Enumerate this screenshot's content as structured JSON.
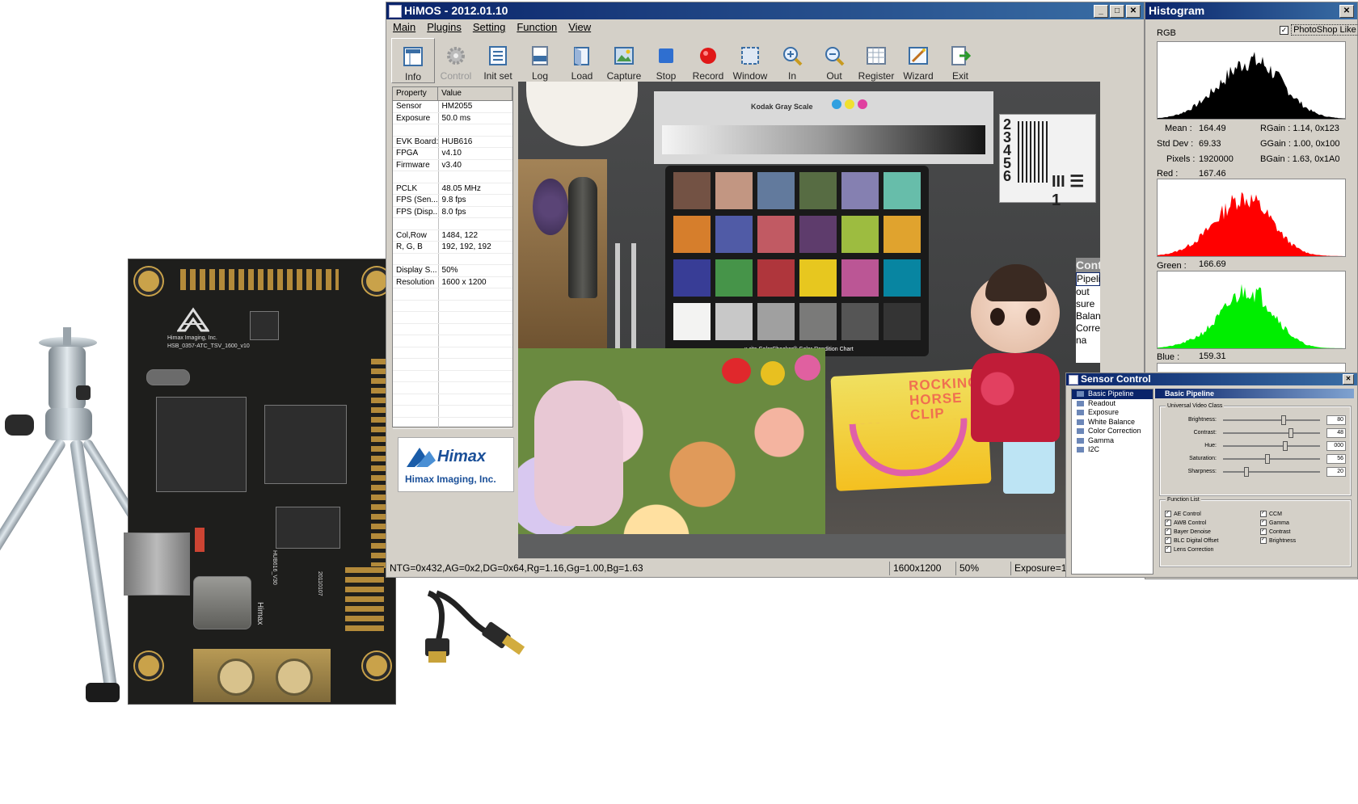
{
  "app": {
    "title": "HiMOS - 2012.01.10",
    "menu": [
      "Main",
      "Plugins",
      "Setting",
      "Function",
      "View"
    ],
    "toolbar": [
      "Info",
      "Control",
      "Init set",
      "Log",
      "Load",
      "Capture",
      "Stop",
      "Record",
      "Window",
      "In",
      "Out",
      "Register",
      "Wizard",
      "Exit"
    ]
  },
  "properties": {
    "headers": [
      "Property",
      "Value"
    ],
    "rows": [
      [
        "Sensor",
        "HM2055"
      ],
      [
        "Exposure",
        "50.0 ms"
      ],
      [
        "",
        ""
      ],
      [
        "EVK Board:",
        "HUB616"
      ],
      [
        "FPGA",
        "v4.10"
      ],
      [
        "Firmware",
        "v3.40"
      ],
      [
        "",
        ""
      ],
      [
        "PCLK",
        "48.05 MHz"
      ],
      [
        "FPS (Sen...",
        "9.8 fps"
      ],
      [
        "FPS (Disp...",
        "8.0 fps"
      ],
      [
        "",
        ""
      ],
      [
        "Col,Row",
        "1484, 122"
      ],
      [
        "R, G, B",
        "192, 192, 192"
      ],
      [
        "",
        ""
      ],
      [
        "Display S...",
        "50%"
      ],
      [
        "Resolution",
        "1600 x 1200"
      ]
    ]
  },
  "logo": {
    "name": "Himax",
    "company": "Himax Imaging, Inc."
  },
  "status": {
    "gains": "NTG=0x432,AG=0x2,DG=0x64,Rg=1.16,Gg=1.00,Bg=1.63",
    "resolution": "1600x1200",
    "zoom": "50%",
    "exposure": "Exposure=1"
  },
  "image": {
    "gray_scale_label": "Kodak Gray Scale",
    "chart_label": "x·rite ColorChecker® Color Rendition Chart",
    "sign_text": "ROCKING HORSE CLIP",
    "bg_panel_title": "Contro",
    "bg_panel_items": [
      "Pipeline",
      "out",
      "sure",
      "Balance",
      "Correctic",
      "na"
    ],
    "checker_colors": [
      "#735244",
      "#c29682",
      "#627a9d",
      "#576c43",
      "#8580b1",
      "#67bdaa",
      "#d67e2c",
      "#505ba6",
      "#c15a63",
      "#5e3c6c",
      "#9dbc40",
      "#e0a32e",
      "#383d96",
      "#469449",
      "#af363c",
      "#e7c71f",
      "#bb5695",
      "#0885a1",
      "#f3f3f2",
      "#c8c8c8",
      "#a0a0a0",
      "#7a7a79",
      "#555555",
      "#343434"
    ]
  },
  "histogram": {
    "title": "Histogram",
    "photoshop_like": "PhotoShop Like",
    "rgb_label": "RGB",
    "mean_label": "Mean :",
    "mean": "164.49",
    "std_label": "Std Dev :",
    "std": "69.33",
    "pixels_label": "Pixels :",
    "pixels": "1920000",
    "rgain": "RGain : 1.14, 0x123",
    "ggain": "GGain : 1.00, 0x100",
    "bgain": "BGain : 1.63, 0x1A0",
    "red_label": "Red :",
    "red": "167.46",
    "green_label": "Green :",
    "green": "166.69",
    "blue_label": "Blue :",
    "blue": "159.31",
    "colors": {
      "rgb": "#000000",
      "red": "#ff0000",
      "green": "#00ee00"
    }
  },
  "sensor_control": {
    "title": "Sensor Control",
    "tree": [
      "Basic Pipeline",
      "Readout",
      "Exposure",
      "White Balance",
      "Color Correction",
      "Gamma",
      "I2C"
    ],
    "panel_title": "Basic Pipeline",
    "video_group": "Universal Video Class",
    "sliders": [
      {
        "label": "Brightness:",
        "value": "80",
        "level": 0.62
      },
      {
        "label": "Contrast:",
        "value": "48",
        "level": 0.7
      },
      {
        "label": "Hue:",
        "value": "000",
        "level": 0.64
      },
      {
        "label": "Saturation:",
        "value": "56",
        "level": 0.45
      },
      {
        "label": "Sharpness:",
        "value": "20",
        "level": 0.22
      }
    ],
    "function_group": "Function List",
    "functions_left": [
      "AE Control",
      "AWB Control",
      "Bayer Denoise",
      "BLC Digital Offset",
      "Lens Correction"
    ],
    "functions_right": [
      "CCM",
      "Gamma",
      "Contrast",
      "Brightness"
    ]
  },
  "board": {
    "brand": "Himax Imaging, Inc.",
    "model": "HSB_0357-ATC_TSV_1600_v10",
    "hub": "HUB616_V30",
    "date": "20110107",
    "brand_vertical": "Himax"
  }
}
